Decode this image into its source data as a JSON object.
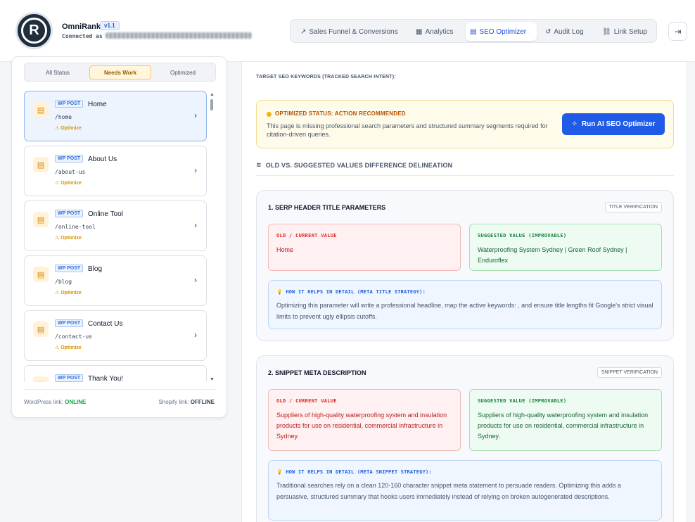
{
  "brand": {
    "logo_letter": "R",
    "logo_ring_text": "OmniRank",
    "name": "OmniRank",
    "version": "v1.1",
    "connected_label": "Connected as"
  },
  "nav": {
    "items": [
      {
        "label": "Sales Funnel & Conversions",
        "icon": "trend-up-icon"
      },
      {
        "label": "Analytics",
        "icon": "grid-icon"
      },
      {
        "label": "SEO Optimizer",
        "icon": "document-icon",
        "active": true
      },
      {
        "label": "Audit Log",
        "icon": "history-icon"
      },
      {
        "label": "Link Setup",
        "icon": "link-icon"
      }
    ],
    "logout_icon": "logout-icon"
  },
  "sidebar": {
    "filters": [
      "All Status",
      "Needs Work",
      "Optimized"
    ],
    "active_filter": "Needs Work",
    "posts": [
      {
        "badge": "WP POST",
        "title": "Home",
        "slug": "/home",
        "status": "Optimize"
      },
      {
        "badge": "WP POST",
        "title": "About Us",
        "slug": "/about-us",
        "status": "Optimize"
      },
      {
        "badge": "WP POST",
        "title": "Online Tool",
        "slug": "/online-tool",
        "status": "Optimize"
      },
      {
        "badge": "WP POST",
        "title": "Blog",
        "slug": "/blog",
        "status": "Optimize"
      },
      {
        "badge": "WP POST",
        "title": "Contact Us",
        "slug": "/contact-us",
        "status": "Optimize"
      },
      {
        "badge": "WP POST",
        "title": "Thank You!",
        "slug": "",
        "status": ""
      }
    ],
    "wordpress_label": "WordPress link:",
    "wordpress_status": "ONLINE",
    "shopify_label": "Shopify link:",
    "shopify_status": "OFFLINE"
  },
  "main": {
    "keywords_label": "TARGET SEO KEYWORDS (TRACKED SEARCH INTENT):",
    "alert": {
      "title": "OPTIMIZED STATUS: ACTION RECOMMENDED",
      "text": "This page is missing professional search parameters and structured summary segments required for citation-driven queries.",
      "button": "Run AI SEO Optimizer"
    },
    "diff_heading": "OLD VS. SUGGESTED VALUES DIFFERENCE DELINEATION",
    "sections": [
      {
        "title": "1. SERP HEADER TITLE PARAMETERS",
        "tag": "TITLE VERIFICATION",
        "old_label": "OLD / CURRENT VALUE",
        "old_value": "Home",
        "new_label": "SUGGESTED VALUE (IMPROVABLE)",
        "new_value": "Waterproofing System Sydney | Green Roof Sydney | Enduroflex",
        "help_title": "HOW IT HELPS IN DETAIL (META TITLE STRATEGY):",
        "help_text": "Optimizing this parameter will write a professional headline, map the active keywords: , and ensure title lengths fit Google's strict visual limits to prevent ugly ellipsis cutoffs."
      },
      {
        "title": "2. SNIPPET META DESCRIPTION",
        "tag": "SNIPPET VERIFICATION",
        "old_label": "OLD / CURRENT VALUE",
        "old_value": "Suppliers of high-quality waterproofing system and insulation products for use on residential, commercial infrastructure in Sydney.",
        "new_label": "SUGGESTED VALUE (IMPROVABLE)",
        "new_value": "Suppliers of high-quality waterproofing system and insulation products for use on residential, commercial infrastructure in Sydney.",
        "help_title": "HOW IT HELPS IN DETAIL (META SNIPPET STRATEGY):",
        "help_text": "Traditional searches rely on a clean 120-160 character snippet meta statement to persuade readers. Optimizing this adds a persuasive, structured summary that hooks users immediately instead of relying on broken autogenerated descriptions."
      }
    ]
  },
  "colors": {
    "accent": "#1f5be6",
    "online": "#16a34a",
    "warning": "#d89200"
  }
}
